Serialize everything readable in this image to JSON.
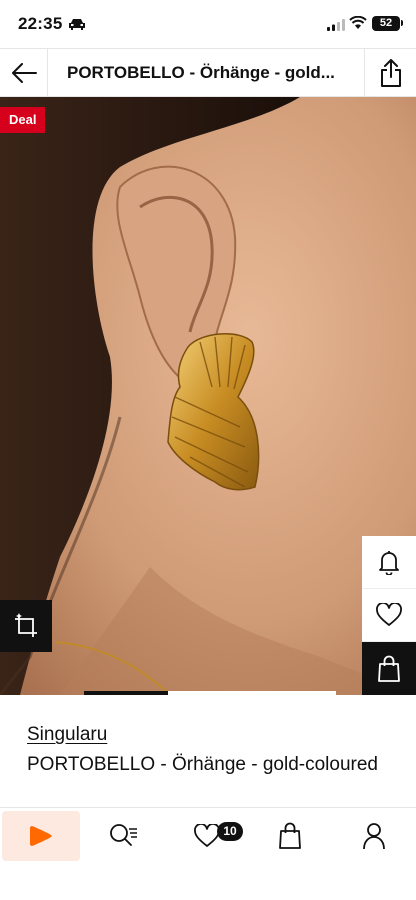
{
  "status_bar": {
    "time": "22:35",
    "battery": "52"
  },
  "header": {
    "title": "PORTOBELLO - Örhänge - gold..."
  },
  "hero": {
    "deal_badge": "Deal",
    "image_alt": "Model wearing gold fan-shaped statement earring"
  },
  "product": {
    "brand": "Singularu",
    "name": "PORTOBELLO - Örhänge - gold-coloured"
  },
  "tabbar": {
    "items": [
      {
        "name": "home",
        "icon": "play-logo-icon"
      },
      {
        "name": "search",
        "icon": "search-filter-icon"
      },
      {
        "name": "wishlist",
        "icon": "heart-icon"
      },
      {
        "name": "cart",
        "icon": "bag-icon"
      },
      {
        "name": "profile",
        "icon": "person-icon"
      }
    ],
    "wishlist_count": "10"
  },
  "colors": {
    "accent": "#ff6900",
    "deal_red": "#d6001c",
    "home_tab_bg": "#fde9e0"
  }
}
